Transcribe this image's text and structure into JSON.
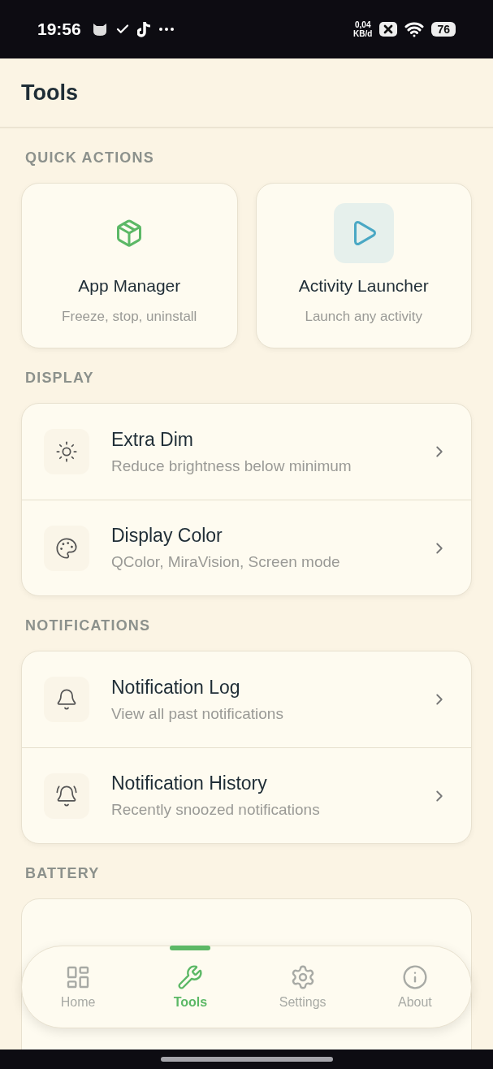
{
  "status_bar": {
    "time": "19:56",
    "data_rate": "0,04",
    "data_unit": "KB/d",
    "battery": "76"
  },
  "header": {
    "title": "Tools"
  },
  "quick_actions": {
    "heading": "QUICK ACTIONS",
    "items": [
      {
        "title": "App Manager",
        "subtitle": "Freeze, stop, uninstall"
      },
      {
        "title": "Activity Launcher",
        "subtitle": "Launch any activity"
      }
    ]
  },
  "sections": [
    {
      "heading": "DISPLAY",
      "items": [
        {
          "title": "Extra Dim",
          "subtitle": "Reduce brightness below minimum"
        },
        {
          "title": "Display Color",
          "subtitle": "QColor, MiraVision, Screen mode"
        }
      ]
    },
    {
      "heading": "NOTIFICATIONS",
      "items": [
        {
          "title": "Notification Log",
          "subtitle": "View all past notifications"
        },
        {
          "title": "Notification History",
          "subtitle": "Recently snoozed notifications"
        }
      ]
    },
    {
      "heading": "BATTERY"
    }
  ],
  "bottom_nav": [
    {
      "label": "Home",
      "selected": false
    },
    {
      "label": "Tools",
      "selected": true
    },
    {
      "label": "Settings",
      "selected": false
    },
    {
      "label": "About",
      "selected": false
    }
  ]
}
